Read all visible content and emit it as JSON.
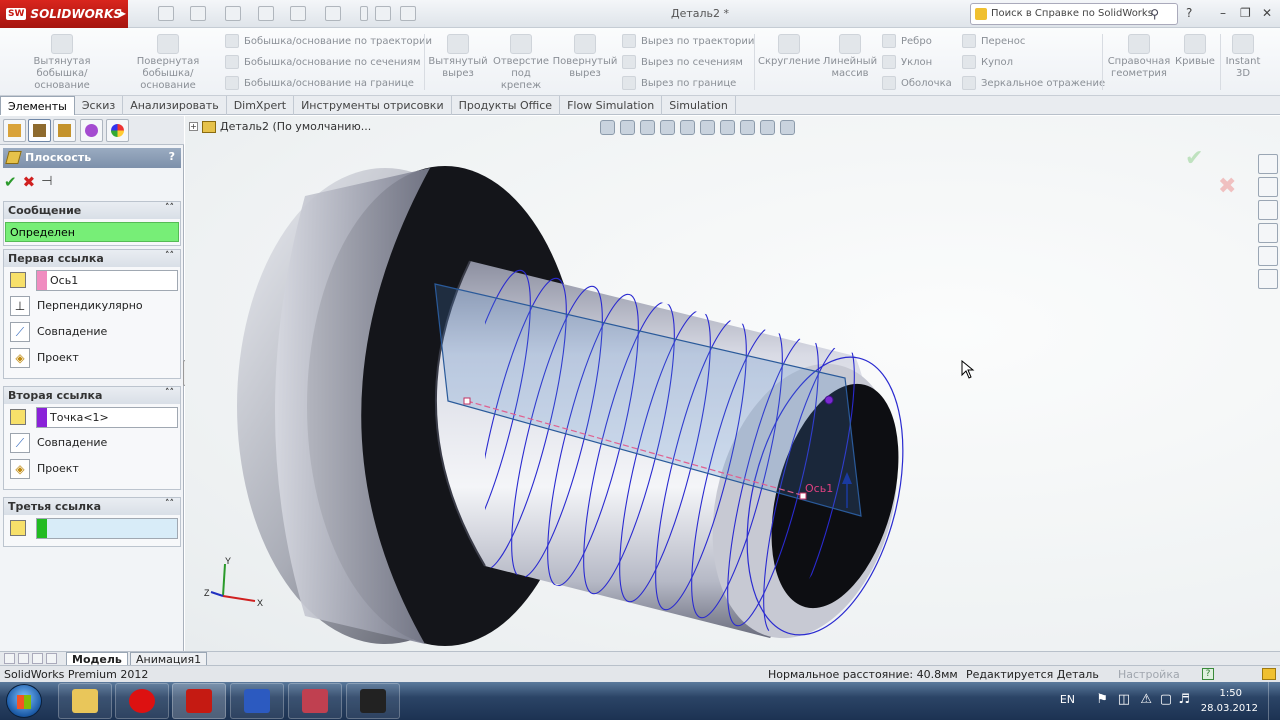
{
  "app": {
    "brand": "SOLIDWORKS",
    "brand_short": "SW",
    "title": "Деталь2 *",
    "help_search": "Поиск в Справке по SolidWorks",
    "help_label": "?"
  },
  "ribbon": {
    "extrude_boss": "Вытянутая бобышка/основание",
    "revolve_boss": "Повернутая бобышка/основание",
    "sweep_boss": "Бобышка/основание по траектории",
    "loft_boss": "Бобышка/основание по сечениям",
    "boundary_boss": "Бобышка/основание на границе",
    "extrude_cut": "Вытянутый вырез",
    "hole": "Отверстие под крепеж",
    "revolve_cut": "Повернутый вырез",
    "sweep_cut": "Вырез по траектории",
    "loft_cut": "Вырез по сечениям",
    "boundary_cut": "Вырез по границе",
    "fillet": "Скругление",
    "linear_pattern": "Линейный массив",
    "rib": "Ребро",
    "draft": "Уклон",
    "shell": "Оболочка",
    "wrap": "Перенос",
    "dome": "Купол",
    "mirror": "Зеркальное отражение",
    "ref_geometry": "Справочная геометрия",
    "curves": "Кривые",
    "instant3d": "Instant 3D"
  },
  "tabs": [
    "Элементы",
    "Эскиз",
    "Анализировать",
    "DimXpert",
    "Инструменты отрисовки",
    "Продукты Office",
    "Flow Simulation",
    "Simulation"
  ],
  "pm": {
    "title": "Плоскость",
    "help": "?",
    "message_header": "Сообщение",
    "message": "Определен",
    "first_ref_header": "Первая ссылка",
    "first_ref_value": "Ось1",
    "first_ref_color": "#f08cc0",
    "first_options": [
      "Перпендикулярно",
      "Совпадение",
      "Проект"
    ],
    "second_ref_header": "Вторая ссылка",
    "second_ref_value": "Точка<1>",
    "second_ref_color": "#8a22d8",
    "second_options": [
      "Совпадение",
      "Проект"
    ],
    "third_ref_header": "Третья ссылка",
    "third_ref_value": "",
    "third_ref_color": "#22bb22"
  },
  "viewport": {
    "tree_label": "Деталь2  (По умолчанию...",
    "axis_label": "Ось1",
    "triad": {
      "x": "X",
      "y": "Y",
      "z": "Z"
    }
  },
  "bottom_tabs": [
    "Модель",
    "Анимация1"
  ],
  "status": {
    "product": "SolidWorks Premium 2012",
    "distance": "Нормальное расстояние: 40.8мм",
    "mode": "Редактируется Деталь",
    "settings": "Настройка"
  },
  "taskbar": {
    "lang": "EN",
    "time": "1:50",
    "date": "28.03.2012"
  },
  "colors": {
    "accent": "#c51a12",
    "helix": "#2a2ad0",
    "plane": "#4a86c8",
    "message_ok": "#77ee77"
  }
}
